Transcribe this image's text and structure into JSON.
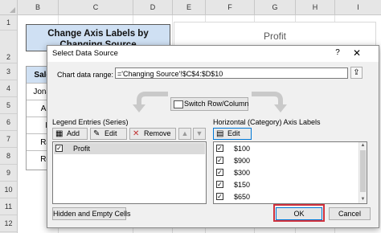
{
  "sheet": {
    "columns": [
      "B",
      "C",
      "D",
      "E",
      "F",
      "G",
      "H",
      "I"
    ],
    "rows": [
      "1",
      "2",
      "3",
      "4",
      "5",
      "6",
      "7",
      "8",
      "9",
      "10",
      "11",
      "12"
    ],
    "title_text": "Change Axis Labels by Changing Source",
    "chart_title": "Profit",
    "left_cells": [
      "Sale",
      "Jona",
      "An",
      "B",
      "Ra",
      "Ro"
    ]
  },
  "dialog": {
    "title": "Select Data Source",
    "help_glyph": "?",
    "close_glyph": "✕",
    "chart_range_label": "Chart data range:",
    "chart_range_value": "='Changing Source'!$C$4:$D$10",
    "collapse_glyph": "⇪",
    "switch_label": "Switch Row/Column",
    "legend_title": "Legend Entries (Series)",
    "legend_buttons": {
      "add": "Add",
      "edit": "Edit",
      "remove": "Remove"
    },
    "series": [
      {
        "name": "Profit",
        "checked": true
      }
    ],
    "axis_title": "Horizontal (Category) Axis Labels",
    "axis_edit": "Edit",
    "axis_labels": [
      {
        "label": "$100",
        "checked": true
      },
      {
        "label": "$900",
        "checked": true
      },
      {
        "label": "$300",
        "checked": true
      },
      {
        "label": "$150",
        "checked": true
      },
      {
        "label": "$650",
        "checked": true
      }
    ],
    "hidden_cells_label": "Hidden and Empty Cells",
    "ok_label": "OK",
    "cancel_label": "Cancel"
  },
  "colors": {
    "accent": "#0078d7",
    "highlight": "#d0313d",
    "title_fill": "#cfe0f3"
  }
}
